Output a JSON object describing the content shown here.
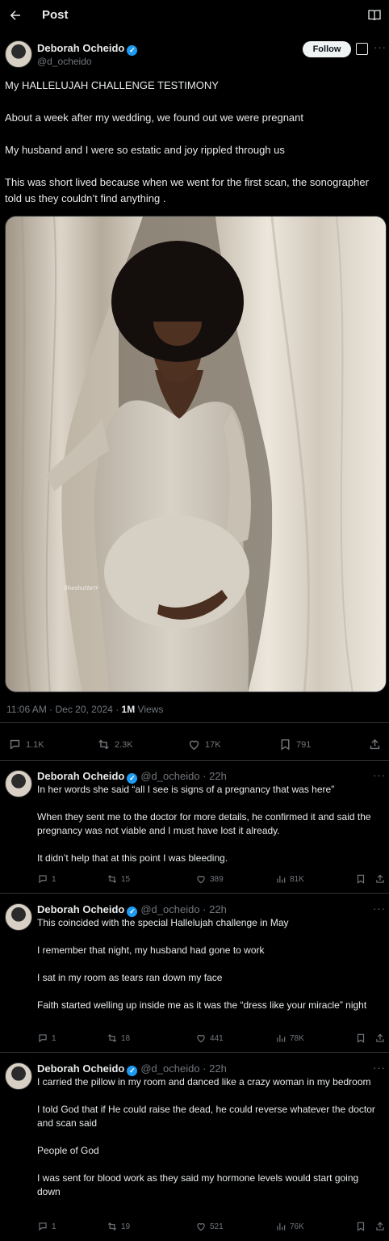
{
  "header": {
    "title": "Post"
  },
  "post": {
    "author_name": "Deborah Ocheido",
    "author_handle": "@d_ocheido",
    "follow_label": "Follow",
    "paragraphs": [
      "My HALLELUJAH CHALLENGE TESTIMONY",
      "About a week after my wedding, we found out we were pregnant",
      "My husband and I were so estatic and joy rippled through us",
      "This was short lived because when we went for the first scan, the sonographer told us they couldn’t find anything ."
    ],
    "timestamp": "11:06 AM · Dec 20, 2024 · ",
    "views_count": "1M",
    "views_label": "Views",
    "stats": {
      "replies": "1.1K",
      "reposts": "2.3K",
      "likes": "17K",
      "bookmarks": "791"
    },
    "photo_watermark": "Sheshutterr"
  },
  "replies": [
    {
      "name": "Deborah Ocheido",
      "handle_time": "@d_ocheido · 22h",
      "paragraphs": [
        "In her words she said “all I see is signs of a pregnancy that was here”",
        "When they sent me to the doctor for more details, he confirmed it and said the pregnancy was not viable and I must have lost it already.",
        "It didn’t help that at this point I was bleeding."
      ],
      "stats": {
        "replies": "1",
        "reposts": "15",
        "likes": "389",
        "views": "81K"
      }
    },
    {
      "name": "Deborah Ocheido",
      "handle_time": "@d_ocheido · 22h",
      "paragraphs": [
        "This coincided with the special Hallelujah challenge in May",
        "I remember that night, my husband had gone to work",
        "I sat in my room as tears ran down my face",
        "Faith started welling up inside me as it was the “dress like your miracle” night"
      ],
      "stats": {
        "replies": "1",
        "reposts": "18",
        "likes": "441",
        "views": "78K"
      }
    },
    {
      "name": "Deborah Ocheido",
      "handle_time": "@d_ocheido · 22h",
      "paragraphs": [
        "I carried the pillow in my room and danced like a crazy woman in my bedroom",
        "I told God that if He could raise the dead, he could reverse whatever the doctor and scan said",
        "People of God",
        "I was sent for blood work as they said my hormone levels would start going down"
      ],
      "stats": {
        "replies": "1",
        "reposts": "19",
        "likes": "521",
        "views": "76K"
      }
    }
  ],
  "colors": {
    "accent": "#1d9bf0",
    "muted": "#71767b",
    "text": "#e7e9ea",
    "divider": "#2f3336"
  }
}
